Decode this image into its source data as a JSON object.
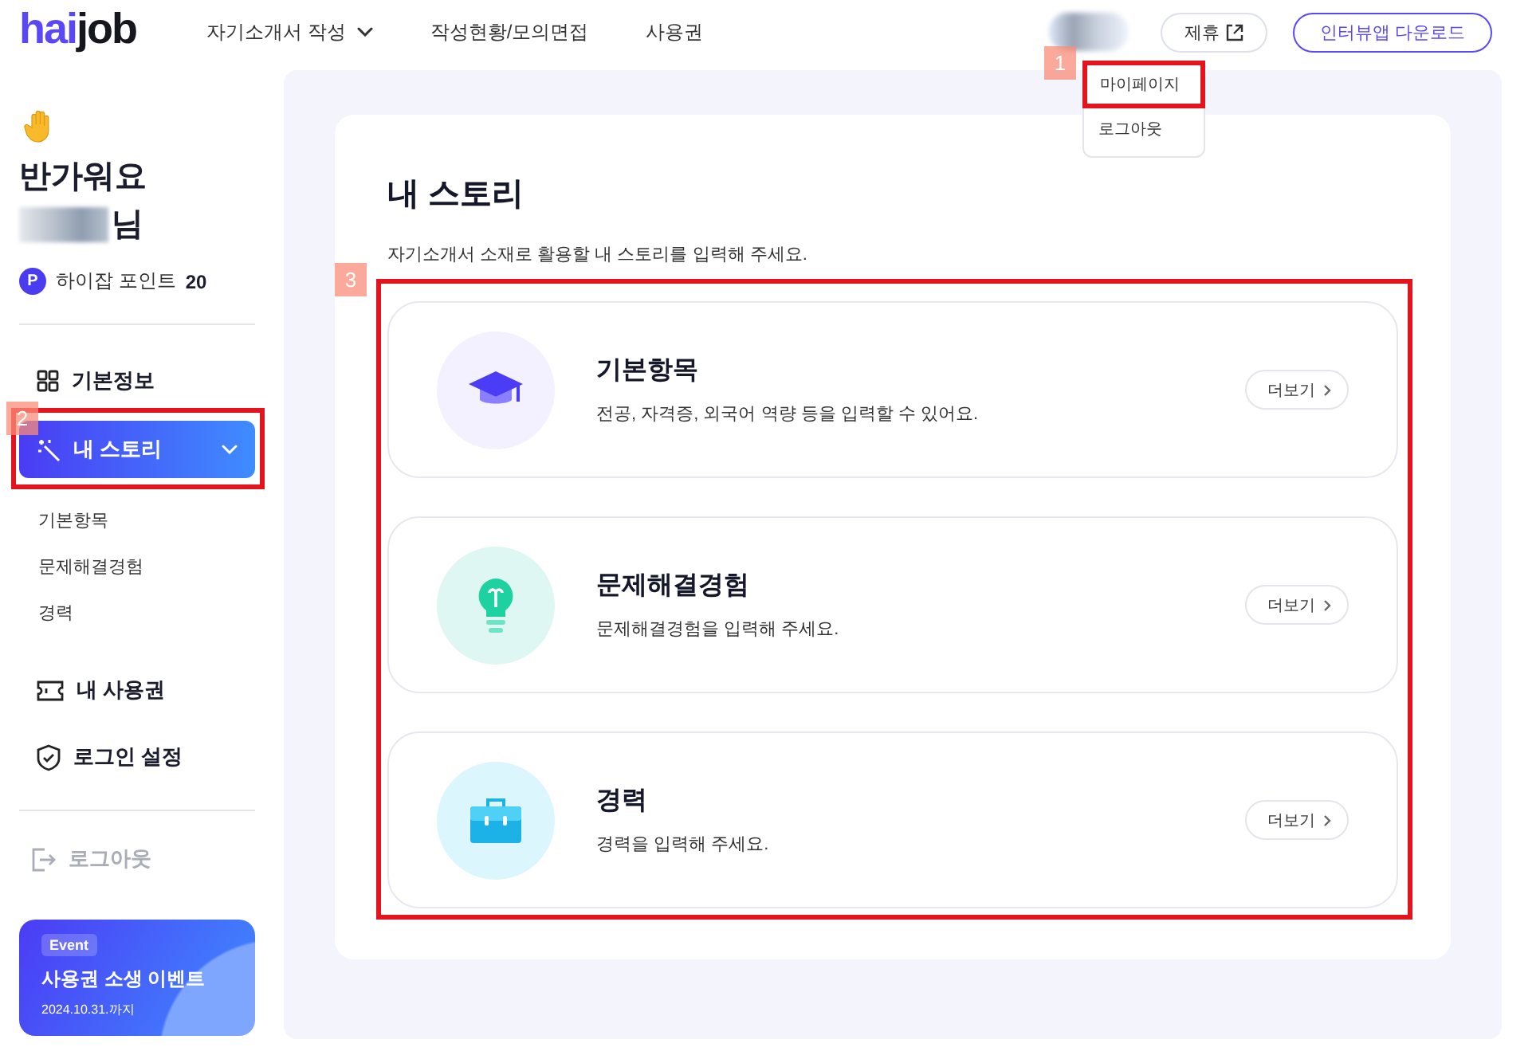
{
  "header": {
    "logo": [
      "hai",
      "job"
    ],
    "nav": [
      {
        "label": "자기소개서 작성",
        "has_caret": true
      },
      {
        "label": "작성현황/모의면접",
        "has_caret": false
      },
      {
        "label": "사용권",
        "has_caret": false
      }
    ],
    "partner_button": "제휴",
    "download_button": "인터뷰앱 다운로드",
    "user_menu": [
      "마이페이지",
      "로그아웃"
    ]
  },
  "sidebar": {
    "greeting": "반가워요",
    "name_suffix": "님",
    "points_badge": "P",
    "points_label": "하이잡 포인트",
    "points_value": "20",
    "menu": [
      {
        "label": "기본정보",
        "selected": false
      },
      {
        "label": "내 스토리",
        "selected": true,
        "expanded": true,
        "children": [
          {
            "label": "기본항목"
          },
          {
            "label": "문제해결경험"
          },
          {
            "label": "경력"
          }
        ]
      },
      {
        "label": "내 사용권",
        "selected": false
      },
      {
        "label": "로그인 설정",
        "selected": false
      }
    ],
    "logout": "로그아웃",
    "event": {
      "tag": "Event",
      "title": "사용권 소생 이벤트",
      "date": "2024.10.31.까지"
    }
  },
  "content": {
    "title": "내 스토리",
    "subtitle": "자기소개서 소재로 활용할 내 스토리를 입력해 주세요.",
    "cards": [
      {
        "title": "기본항목",
        "description": "전공, 자격증, 외국어 역량 등을 입력할 수 있어요.",
        "button": "더보기"
      },
      {
        "title": "문제해결경험",
        "description": "문제해결경험을 입력해 주세요.",
        "button": "더보기"
      },
      {
        "title": "경력",
        "description": "경력을 입력해 주세요.",
        "button": "더보기"
      }
    ]
  },
  "annotations": [
    {
      "number": "1"
    },
    {
      "number": "2"
    },
    {
      "number": "3"
    }
  ]
}
